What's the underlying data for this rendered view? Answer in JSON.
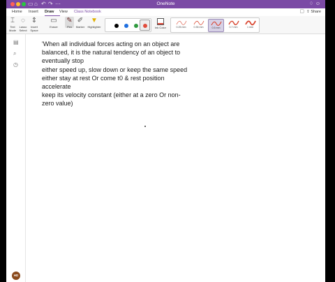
{
  "app": {
    "title": "OneNote",
    "share_label": "Share"
  },
  "tabs": [
    {
      "label": "Home"
    },
    {
      "label": "Insert"
    },
    {
      "label": "Draw"
    },
    {
      "label": "View"
    },
    {
      "label": "Class Notebook"
    }
  ],
  "ribbon": {
    "tools": [
      {
        "label": "Text Mode"
      },
      {
        "label": "Lasso Select"
      },
      {
        "label": "Insert Space"
      },
      {
        "label": "Eraser"
      },
      {
        "label": "Pen"
      },
      {
        "label": "Marker"
      },
      {
        "label": "Highlighter"
      }
    ],
    "colors": [
      "#000000",
      "#1f6fe0",
      "#2e9a3e",
      "#e14c3c"
    ],
    "ink_color_label": "Ink Color",
    "thickness": [
      {
        "label": "0.25 mm"
      },
      {
        "label": "0.35 mm"
      },
      {
        "label": "0.5 mm"
      },
      {
        "label": "0.7 mm"
      },
      {
        "label": "1 mm"
      }
    ]
  },
  "user": {
    "initials": "HD"
  },
  "note": {
    "lines": [
      "'When all individual forces acting on an object are",
      "balanced, it is the natural tendency of an object to",
      "eventually stop",
      "either speed up, slow down or keep the same speed",
      "either stay at rest Or come t0 & rest position",
      "accelerate",
      "keep its velocity constant (either at a zero Or non-",
      "zero value)"
    ]
  }
}
